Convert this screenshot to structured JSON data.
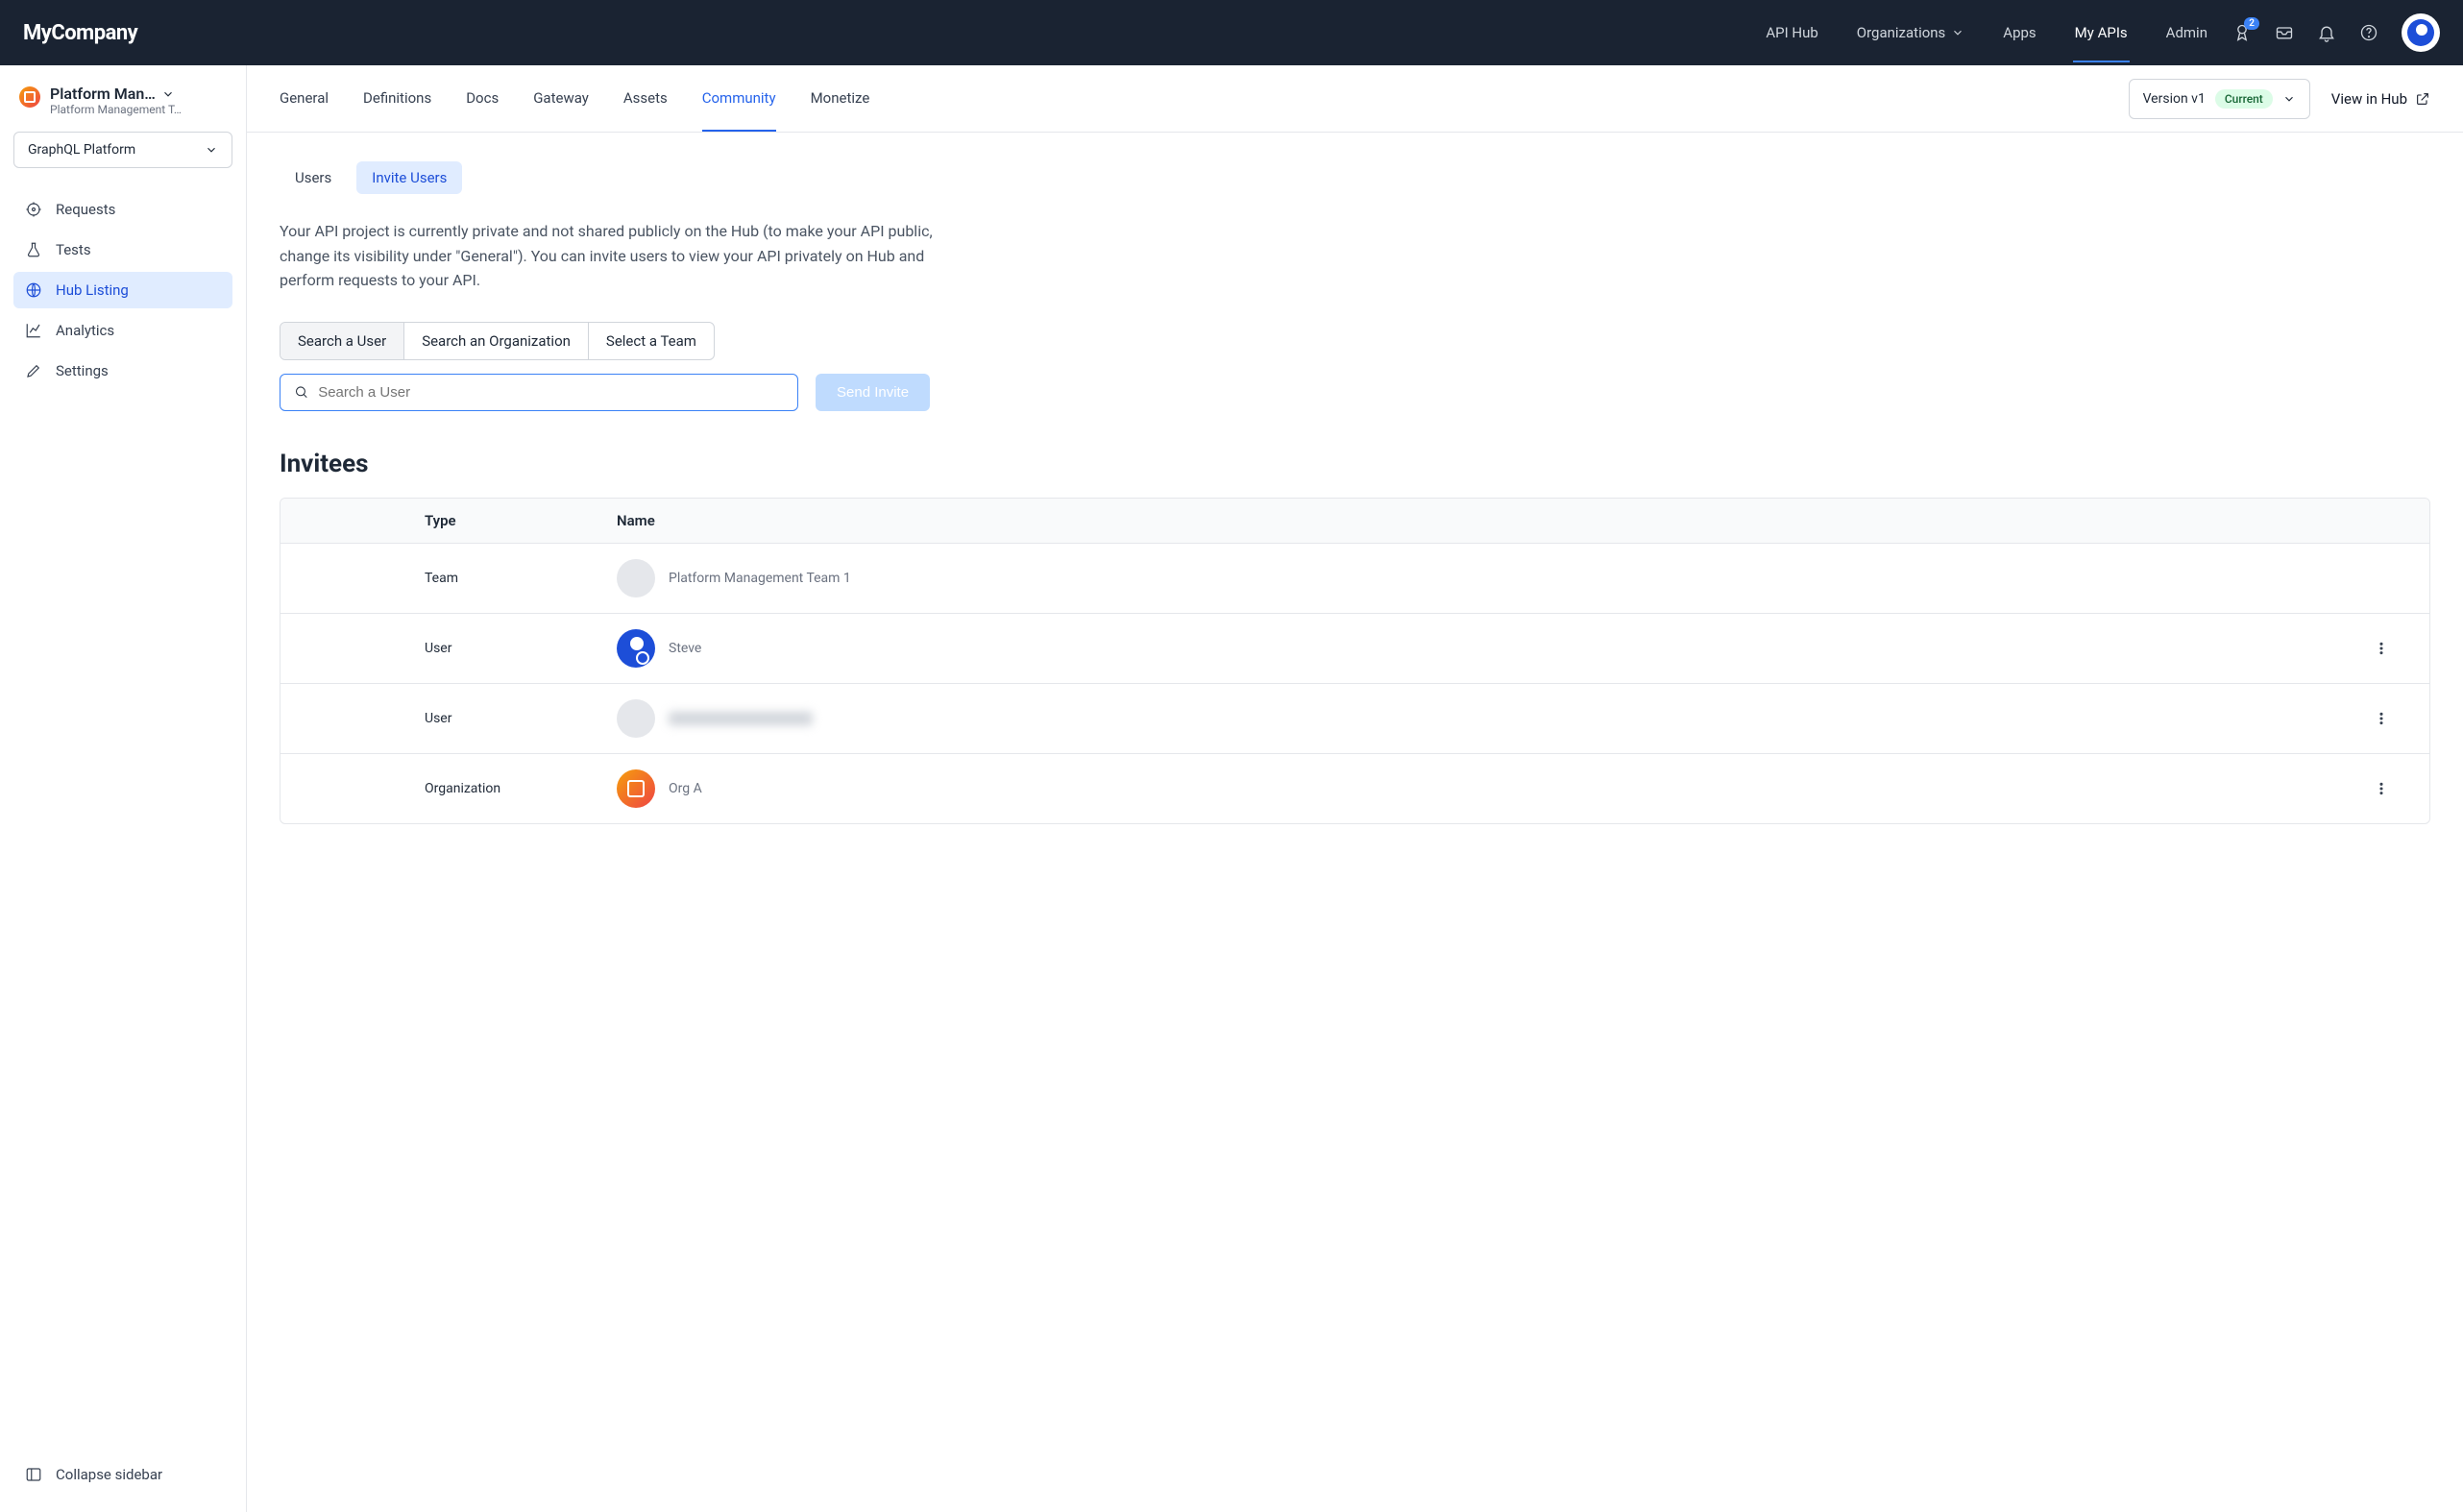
{
  "header": {
    "logo": "MyCompany",
    "nav": {
      "api_hub": "API Hub",
      "organizations": "Organizations",
      "apps": "Apps",
      "my_apis": "My APIs",
      "admin": "Admin"
    },
    "notification_badge": "2"
  },
  "sidebar": {
    "project_title": "Platform Man…",
    "project_subtitle": "Platform Management T…",
    "selector_label": "GraphQL Platform",
    "items": {
      "requests": "Requests",
      "tests": "Tests",
      "hub_listing": "Hub Listing",
      "analytics": "Analytics",
      "settings": "Settings"
    },
    "collapse": "Collapse sidebar"
  },
  "tabs": {
    "general": "General",
    "definitions": "Definitions",
    "docs": "Docs",
    "gateway": "Gateway",
    "assets": "Assets",
    "community": "Community",
    "monetize": "Monetize",
    "version_label": "Version v1",
    "version_chip": "Current",
    "view_hub": "View in Hub"
  },
  "content": {
    "subtabs": {
      "users": "Users",
      "invite": "Invite Users"
    },
    "description": "Your API project is currently private and not shared publicly on the Hub (to make your API public, change its visibility under \"General\"). You can invite users to view your API privately on Hub and perform requests to your API.",
    "segments": {
      "user": "Search a User",
      "org": "Search an Organization",
      "team": "Select a Team"
    },
    "search_placeholder": "Search a User",
    "send_invite": "Send Invite",
    "invitees_title": "Invitees",
    "table": {
      "col_type": "Type",
      "col_name": "Name",
      "rows": [
        {
          "type": "Team",
          "name": "Platform Management Team 1",
          "avatar": "gray",
          "more": false
        },
        {
          "type": "User",
          "name": "Steve",
          "avatar": "blue",
          "more": true
        },
        {
          "type": "User",
          "name": "redacted",
          "avatar": "gray",
          "more": true,
          "blurred": true
        },
        {
          "type": "Organization",
          "name": "Org A",
          "avatar": "org",
          "more": true
        }
      ]
    }
  }
}
